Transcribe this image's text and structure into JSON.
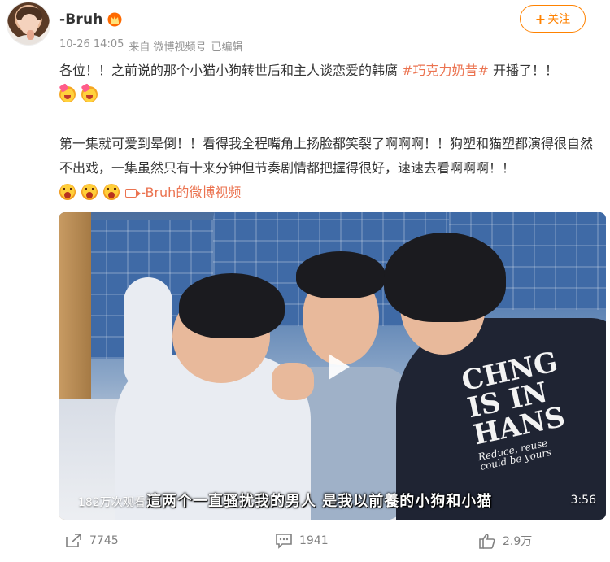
{
  "user": {
    "name": "-Bruh",
    "avatar_icon": "user-avatar",
    "vip_icon": "vip-crown-icon"
  },
  "meta": {
    "time": "10-26 14:05",
    "source": "来自 微博视频号",
    "edited": "已编辑"
  },
  "follow_button": {
    "plus": "+",
    "label": "关注",
    "color": "#ff8200"
  },
  "post": {
    "line1_before": "各位！！之前说的那个小猫小狗转世后和主人谈恋爱的韩腐 ",
    "hashtag": "#巧克力奶昔#",
    "line1_after": " 开播了！！",
    "paragraph2": "第一集就可爱到晕倒！！看得我全程嘴角上扬脸都笑裂了啊啊啊！！狗塑和猫塑都演得很自然不出戏，一集虽然只有十来分钟但节奏剧情都把握得很好，速速去看啊啊啊！！",
    "video_link_label": "-Bruh的微博视频",
    "link_color": "#eb7350"
  },
  "video": {
    "views": "182万次观看",
    "subtitle": "這两个一直骚扰我的男人 是我以前養的小狗和小猫",
    "duration": "3:56",
    "shirt_print_line1": "CHNG",
    "shirt_print_line2": "IS IN",
    "shirt_print_line3": "HANS",
    "shirt_print_small1": "Reduce, reuse",
    "shirt_print_small2": "could be yours"
  },
  "actions": {
    "repost_count": "7745",
    "comment_count": "1941",
    "like_count": "2.9万"
  }
}
